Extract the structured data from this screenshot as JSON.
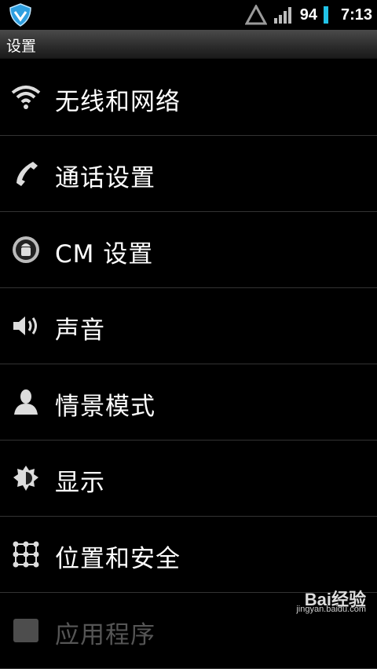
{
  "status_bar": {
    "signal_text": "94",
    "time": "7:13",
    "battery_color": "#21c3e8",
    "icons": [
      "shield-icon",
      "warning-triangle-icon",
      "signal-bars-icon",
      "battery-icon"
    ]
  },
  "title_bar": {
    "title": "设置"
  },
  "settings": [
    {
      "label": "无线和网络",
      "icon": "wifi-icon"
    },
    {
      "label": "通话设置",
      "icon": "phone-icon"
    },
    {
      "label": "CM 设置",
      "icon": "cm-android-icon"
    },
    {
      "label": "声音",
      "icon": "speaker-icon"
    },
    {
      "label": "情景模式",
      "icon": "person-icon"
    },
    {
      "label": "显示",
      "icon": "brightness-icon"
    },
    {
      "label": "位置和安全",
      "icon": "location-grid-icon"
    },
    {
      "label": "应用程序",
      "icon": "apps-icon"
    }
  ],
  "watermark": {
    "main": "Bai经验",
    "sub": "jingyan.baidu.com"
  }
}
